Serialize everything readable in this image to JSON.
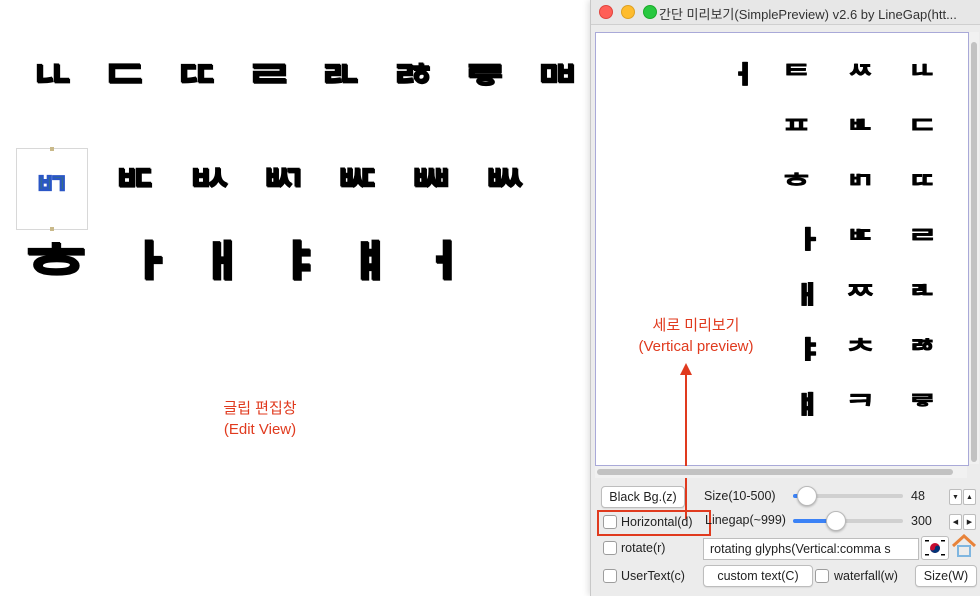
{
  "edit_view": {
    "row1": [
      "ᄔ",
      "ᄃ",
      "ᄄ",
      "ᄅ",
      "ᄘ",
      "ᄚ",
      "ᄛ",
      "ᄜ"
    ],
    "selected_glyph": "ᄞ",
    "row2": [
      "ᄞ",
      "ᄠ",
      "ᄡ",
      "ᄢ",
      "ᄣ",
      "ᄤ",
      "ᄥ"
    ],
    "row3": [
      "ᄒ",
      "ᅡ",
      "ᅢ",
      "ᅣ",
      "ᅤ",
      "ᅥ"
    ],
    "annotation": {
      "line1": "글립 편집창",
      "line2": "(Edit View)"
    }
  },
  "preview_window": {
    "title": "간단 미리보기(SimplePreview) v2.6 by LineGap(htt...",
    "columns": [
      [
        "ᅥ"
      ],
      [
        "ᄐ",
        "ᄑ",
        "ᄒ",
        "ᅡ",
        "ᅢ",
        "ᅣ",
        "ᅤ"
      ],
      [
        "ᄶ",
        "ᄟ",
        "ᄞ",
        "ᄠ",
        "ᄍ",
        "ᄎ",
        "ᄏ"
      ],
      [
        "ᄔ",
        "ᄃ",
        "ᄄ",
        "ᄅ",
        "ᄘ",
        "ᄚ",
        "ᄛ"
      ]
    ],
    "annotation": {
      "line1": "세로 미리보기",
      "line2": "(Vertical preview)"
    }
  },
  "controls": {
    "black_bg_button": "Black Bg.(z)",
    "size_label": "Size(10-500)",
    "size_value": "48",
    "size_slider_fraction": 0.035,
    "horizontal_label": "Horizontal(d)",
    "linegap_label": "Linegap(~999)",
    "linegap_value": "300",
    "linegap_slider_fraction": 0.3,
    "rotate_label": "rotate(r)",
    "rotate_text": "rotating glyphs(Vertical:comma s",
    "usertext_label": "UserText(c)",
    "custom_text_button": "custom text(C)",
    "waterfall_label": "waterfall(w)",
    "size_button": "Size(W)",
    "step_up": "▲",
    "step_down": "▼",
    "step_left": "◀",
    "step_right": "▶"
  },
  "colors": {
    "annotation_red": "#e03a1e",
    "slider_blue": "#3b82f6",
    "close": "#ff5f57",
    "minimize": "#febc2e",
    "maximize": "#28c840"
  }
}
